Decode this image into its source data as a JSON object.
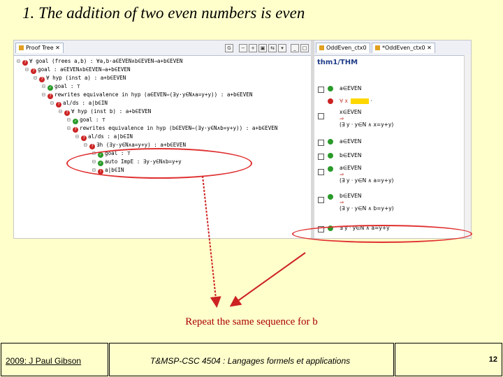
{
  "slide": {
    "title": "1. The addition of two even numbers is even",
    "annotation": "Repeat the same sequence  for b",
    "colors": {
      "background": "#ffffcc",
      "annotation": "#aa0000",
      "ellipse": "#e03030",
      "arrow": "#cc2222"
    }
  },
  "proof_tree": {
    "tab_label": "Proof Tree",
    "rows": [
      {
        "icon": "red",
        "text": "∀ goal (frees a,b) : ∀a,b·a∈EVEN∧b∈EVEN⇒a+b∈EVEN"
      },
      {
        "icon": "red",
        "text": "goal : a∈EVEN∧b∈EVEN⇒a+b∈EVEN"
      },
      {
        "icon": "red",
        "text": "∀ hyp (inst a) : a+b∈EVEN"
      },
      {
        "icon": "green",
        "text": "goal : ⊤"
      },
      {
        "icon": "red",
        "text": "rewrites equivalence in hyp (a∈EVEN⇔(∃y·y∈N∧a=y+y)) : a+b∈EVEN"
      },
      {
        "icon": "red",
        "text": "al/ds : a|b∈IN"
      },
      {
        "icon": "red",
        "text": "∀ hyp (inst b) : a+b∈EVEN"
      },
      {
        "icon": "green",
        "text": "goal : ⊤"
      },
      {
        "icon": "red",
        "text": "rewrites equivalence in hyp (b∈EVEN⇔(∃y·y∈N∧b=y+y)) : a+b∈EVEN"
      },
      {
        "icon": "red",
        "text": "al/ds : a|b∈IN"
      },
      {
        "icon": "red",
        "text": "∃h (∃y·y∈N∧a=y+y) : a+b∈EVEN"
      },
      {
        "icon": "green",
        "text": "goal : ⊤"
      },
      {
        "icon": "green",
        "text": "auto ImpE : ∃y·y∈N∧b=y+y"
      },
      {
        "icon": "red",
        "text": "a|b∈IN"
      }
    ]
  },
  "proof_state": {
    "tabs": [
      "OddEven_ctx0",
      "*OddEven_ctx0"
    ],
    "title": "thm1/THM",
    "rows": [
      {
        "lines": [
          "a∈EVEN"
        ]
      },
      {
        "lines": [
          "∀  x"
        ]
      },
      {
        "lines": [
          "x∈EVEN",
          "⇒",
          "(∃ y · y∈N ∧ x=y+y)"
        ]
      },
      {
        "lines": [
          "a∈EVEN"
        ]
      },
      {
        "lines": [
          "b∈EVEN"
        ]
      },
      {
        "lines": [
          "a∈EVEN",
          "⇒",
          "(∃ y · y∈N ∧ a=y+y)"
        ]
      },
      {
        "lines": [
          "b∈EVEN",
          "⇒",
          "(∃ y · y∈N ∧ b=y+y)"
        ]
      },
      {
        "lines": [
          "∃ y · y∈N ∧ a=y+y"
        ]
      }
    ]
  },
  "footer": {
    "author": "2009: J Paul Gibson",
    "course": "T&MSP-CSC 4504 : Langages formels et applications",
    "page_number": "12"
  }
}
